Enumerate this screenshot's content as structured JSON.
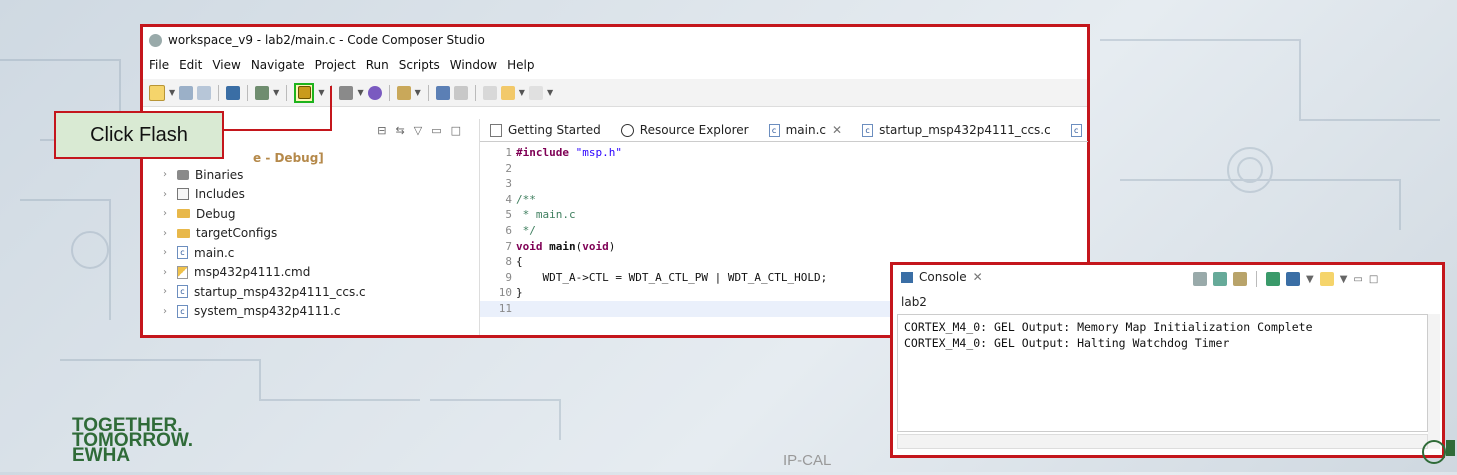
{
  "window": {
    "title": "workspace_v9 - lab2/main.c - Code Composer Studio"
  },
  "menu": [
    "File",
    "Edit",
    "View",
    "Navigate",
    "Project",
    "Run",
    "Scripts",
    "Window",
    "Help"
  ],
  "callout": {
    "label": "Click Flash"
  },
  "explorer": {
    "project_label": "e - Debug]",
    "items": [
      {
        "label": "Binaries",
        "icon": "binaries-icon"
      },
      {
        "label": "Includes",
        "icon": "includes-icon"
      },
      {
        "label": "Debug",
        "icon": "folder-icon"
      },
      {
        "label": "targetConfigs",
        "icon": "folder-icon"
      },
      {
        "label": "main.c",
        "icon": "c-file-icon"
      },
      {
        "label": "msp432p4111.cmd",
        "icon": "cmd-file-icon"
      },
      {
        "label": "startup_msp432p4111_ccs.c",
        "icon": "c-file-icon"
      },
      {
        "label": "system_msp432p4111.c",
        "icon": "c-file-icon"
      }
    ]
  },
  "editor": {
    "tabs": [
      "Getting Started",
      "Resource Explorer",
      "main.c",
      "startup_msp432p4111_ccs.c"
    ],
    "lines": [
      {
        "n": "1",
        "code": "#include \"msp.h\""
      },
      {
        "n": "2",
        "code": ""
      },
      {
        "n": "3",
        "code": ""
      },
      {
        "n": "4",
        "code": "/**"
      },
      {
        "n": "5",
        "code": " * main.c"
      },
      {
        "n": "6",
        "code": " */"
      },
      {
        "n": "7",
        "code": "void main(void)"
      },
      {
        "n": "8",
        "code": "{"
      },
      {
        "n": "9",
        "code": "    WDT_A->CTL = WDT_A_CTL_PW | WDT_A_CTL_HOLD;"
      },
      {
        "n": "10",
        "code": "}"
      },
      {
        "n": "11",
        "code": ""
      }
    ]
  },
  "console": {
    "title": "Console",
    "name": "lab2",
    "lines": [
      "CORTEX_M4_0: GEL Output: Memory Map Initialization Complete",
      "CORTEX_M4_0: GEL Output: Halting Watchdog Timer"
    ]
  },
  "footer": {
    "logo_line1": "TOGETHER.",
    "logo_line2": "TOMORROW.",
    "logo_line3": "EWHA",
    "page_text": "IP-CAL"
  },
  "colors": {
    "highlight_border": "#c4161c",
    "callout_bg": "#d9ead3",
    "flash_button_border": "#1db31d"
  }
}
